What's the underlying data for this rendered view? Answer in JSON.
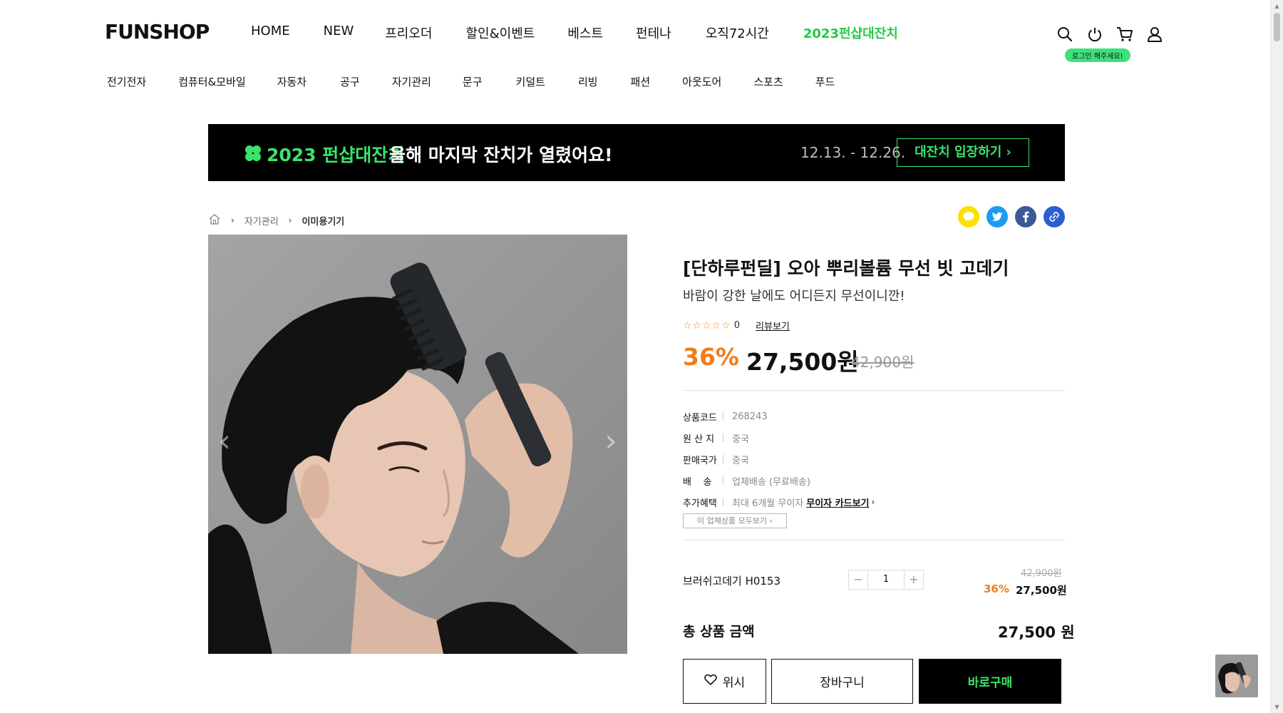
{
  "header": {
    "logo": "FUNSHOP",
    "gnb": [
      "HOME",
      "NEW",
      "프리오더",
      "할인&이벤트",
      "베스트",
      "펀테나",
      "오직72시간",
      "2023펀샵대잔치"
    ],
    "login_tip": "로그인 해주세요!",
    "icons": [
      "search-icon",
      "power-icon",
      "cart-icon",
      "user-icon"
    ]
  },
  "categories": [
    "전기전자",
    "컴퓨터&모바일",
    "자동차",
    "공구",
    "자기관리",
    "문구",
    "키덜트",
    "리빙",
    "패션",
    "아웃도어",
    "스포츠",
    "푸드"
  ],
  "banner": {
    "title": "2023 펀샵대잔치",
    "subtitle": "올해 마지막 잔치가 열렸어요!",
    "date": "12.13. - 12.26.",
    "button": "대잔치 입장하기"
  },
  "breadcrumb": {
    "level1": "자기관리",
    "level2": "이미용기기"
  },
  "share_icons": [
    "kakaotalk-icon",
    "twitter-icon",
    "facebook-icon",
    "link-icon"
  ],
  "product": {
    "title": "[단하루펀딜] 오아 뿌리볼륨 무선 빗 고데기",
    "subtitle": "바람이 강한 날에도 어디든지 무선이니깐!",
    "rating_stars": "☆☆☆☆☆",
    "review_count": "0",
    "review_link": "리뷰보기",
    "discount": "36%",
    "price": "27,500원",
    "original_price": "42,900원",
    "info": [
      {
        "label": "상품코드",
        "value": "268243"
      },
      {
        "label": "원 산 지",
        "value": "중국"
      },
      {
        "label": "판매국가",
        "value": "중국"
      },
      {
        "label": "배    송",
        "value": "업체배송 (무료배송)"
      },
      {
        "label": "추가혜택",
        "value": "최대 6개월 무이자",
        "link": "무이자 카드보기"
      }
    ],
    "all_products_button": "이 업체상품 모두보기"
  },
  "option": {
    "name": "브러쉬고데기 H0153",
    "quantity": "1",
    "original_price": "42,900원",
    "discount": "36%",
    "price": "27,500원"
  },
  "total": {
    "label": "총 상품 금액",
    "price": "27,500 원"
  },
  "actions": {
    "wish": "위시",
    "cart": "장바구니",
    "buy": "바로구매"
  },
  "colors": {
    "accent_green": "#3be36b",
    "discount_orange": "#f07d1a",
    "banner_bg": "#000000"
  }
}
